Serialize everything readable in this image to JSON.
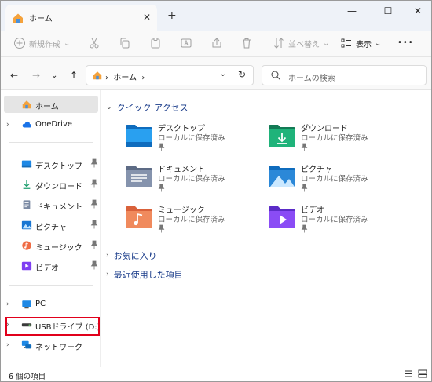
{
  "window": {
    "tab_title": "ホーム",
    "new_tab": "+"
  },
  "window_controls": {
    "minimize": "—",
    "maximize": "☐",
    "close": "✕"
  },
  "toolbar": {
    "new_label": "新規作成",
    "sort_label": "並べ替え",
    "view_label": "表示",
    "more": "•••"
  },
  "address": {
    "path": "ホーム",
    "search_placeholder": "ホームの検索"
  },
  "sidebar": {
    "home": "ホーム",
    "onedrive": "OneDrive",
    "pinned": [
      "デスクトップ",
      "ダウンロード",
      "ドキュメント",
      "ピクチャ",
      "ミュージック",
      "ビデオ"
    ],
    "pc": "PC",
    "usb": "USBドライブ (D:)",
    "network": "ネットワーク"
  },
  "content": {
    "quick_access": "クイック アクセス",
    "favorites": "お気に入り",
    "recent": "最近使用した項目",
    "items": [
      {
        "name": "デスクトップ",
        "sub": "ローカルに保存済み"
      },
      {
        "name": "ダウンロード",
        "sub": "ローカルに保存済み"
      },
      {
        "name": "ドキュメント",
        "sub": "ローカルに保存済み"
      },
      {
        "name": "ピクチャ",
        "sub": "ローカルに保存済み"
      },
      {
        "name": "ミュージック",
        "sub": "ローカルに保存済み"
      },
      {
        "name": "ビデオ",
        "sub": "ローカルに保存済み"
      }
    ]
  },
  "status": {
    "count": "6 個の項目"
  },
  "colors": {
    "highlight": "#e1001b",
    "folder_blue": "#1e88e5",
    "accent": "#0067c0"
  }
}
